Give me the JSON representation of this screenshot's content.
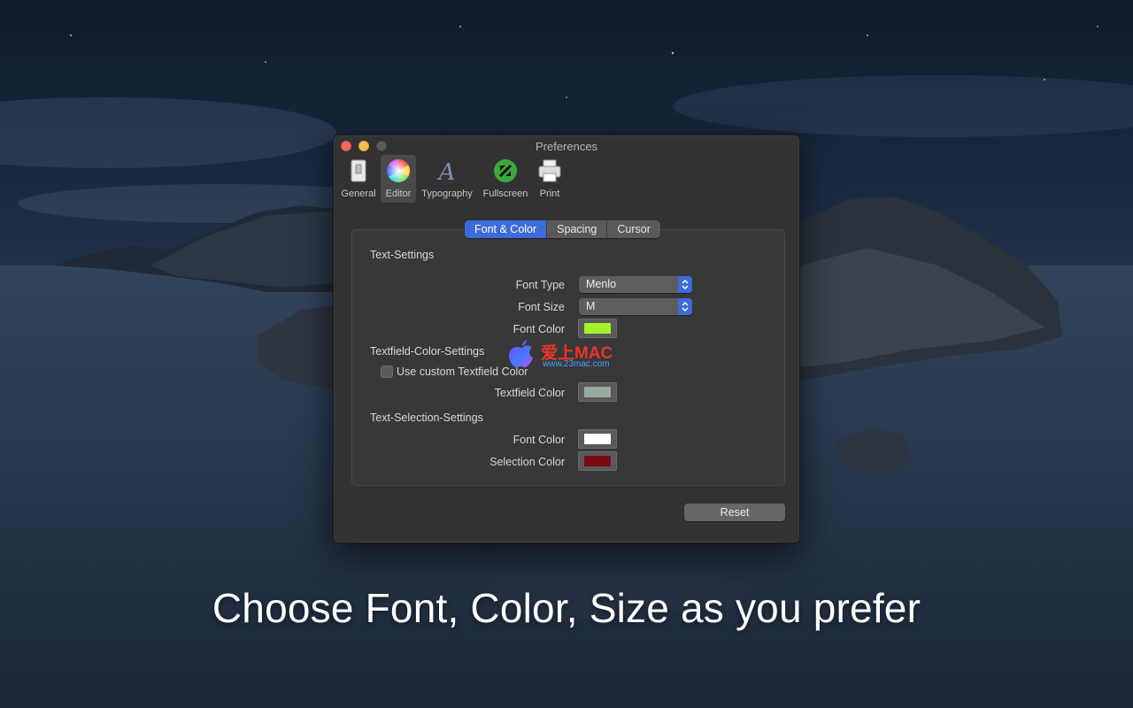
{
  "caption": "Choose Font, Color, Size as you prefer",
  "window": {
    "title": "Preferences"
  },
  "toolbar": {
    "items": [
      {
        "label": "General",
        "icon": "switch-icon"
      },
      {
        "label": "Editor",
        "icon": "color-wheel-icon",
        "selected": true
      },
      {
        "label": "Typography",
        "icon": "typography-icon"
      },
      {
        "label": "Fullscreen",
        "icon": "fullscreen-icon"
      },
      {
        "label": "Print",
        "icon": "printer-icon"
      }
    ]
  },
  "tabs": [
    {
      "label": "Font & Color",
      "active": true
    },
    {
      "label": "Spacing",
      "active": false
    },
    {
      "label": "Cursor",
      "active": false
    }
  ],
  "text_settings": {
    "title": "Text-Settings",
    "font_type": {
      "label": "Font Type",
      "value": "Menlo"
    },
    "font_size": {
      "label": "Font Size",
      "value": "M"
    },
    "font_color": {
      "label": "Font Color",
      "color": "#a6f22a"
    }
  },
  "textfield_settings": {
    "title": "Textfield-Color-Settings",
    "use_custom": {
      "label": "Use custom Textfield Color",
      "checked": false
    },
    "textfield_color": {
      "label": "Textfield Color",
      "color": "#9aaba2"
    }
  },
  "selection_settings": {
    "title": "Text-Selection-Settings",
    "font_color": {
      "label": "Font Color",
      "color": "#ffffff"
    },
    "selection_color": {
      "label": "Selection Color",
      "color": "#7a0a12"
    }
  },
  "reset_label": "Reset",
  "watermark": {
    "text": "爱上MAC",
    "url": "www.23mac.com"
  },
  "colors": {
    "accent": "#3d6bd9",
    "window_bg": "#323232"
  }
}
